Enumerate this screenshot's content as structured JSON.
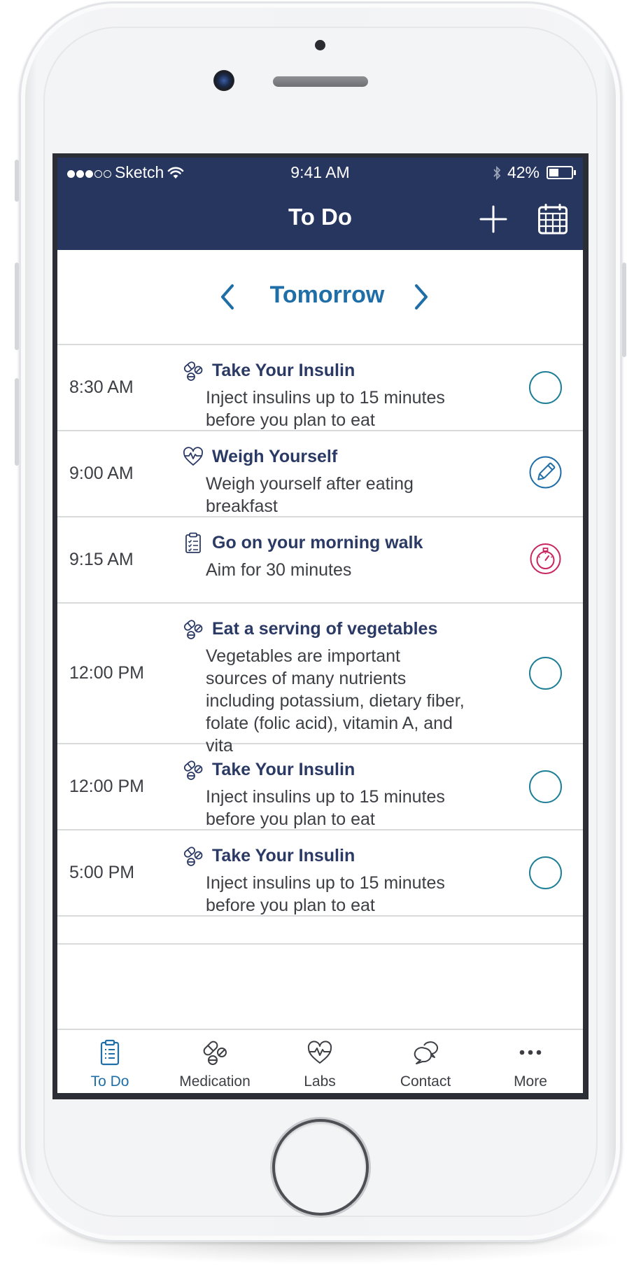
{
  "status_bar": {
    "signal_full": 3,
    "signal_empty": 2,
    "carrier": "Sketch",
    "time": "9:41 AM",
    "battery_percent": "42%",
    "battery_level": 0.42
  },
  "header": {
    "title": "To Do",
    "add_icon": "plus-icon",
    "calendar_icon": "calendar-icon"
  },
  "date_nav": {
    "label": "Tomorrow",
    "prev_icon": "chevron-left-icon",
    "next_icon": "chevron-right-icon"
  },
  "tasks": [
    {
      "time": "8:30 AM",
      "icon": "pills-icon",
      "title": "Take Your Insulin",
      "description": "Inject insulins up to 15 minutes before you plan to eat",
      "action": "complete-circle"
    },
    {
      "time": "9:00 AM",
      "icon": "heart-pulse-icon",
      "title": "Weigh Yourself",
      "description": "Weigh yourself after eating breakfast",
      "action": "edit-pencil"
    },
    {
      "time": "9:15 AM",
      "icon": "clipboard-checklist-icon",
      "title": "Go on your morning walk",
      "description": "Aim for 30 minutes",
      "action": "stopwatch"
    },
    {
      "time": "12:00 PM",
      "icon": "pills-icon",
      "title": "Eat a serving of vegetables",
      "description": "Vegetables are important sources of many nutrients including potassium, dietary fiber, folate (folic acid), vitamin A, and vita",
      "action": "complete-circle"
    },
    {
      "time": "12:00 PM",
      "icon": "pills-icon",
      "title": "Take Your Insulin",
      "description": "Inject insulins up to 15 minutes before you plan to eat",
      "action": "complete-circle"
    },
    {
      "time": "5:00 PM",
      "icon": "pills-icon",
      "title": "Take Your Insulin",
      "description": "Inject insulins up to 15 minutes before you plan to eat",
      "action": "complete-circle"
    }
  ],
  "tabbar": {
    "tabs": [
      {
        "label": "To Do",
        "icon": "clipboard-icon",
        "active": true
      },
      {
        "label": "Medication",
        "icon": "pills-icon",
        "active": false
      },
      {
        "label": "Labs",
        "icon": "heart-pulse-icon",
        "active": false
      },
      {
        "label": "Contact",
        "icon": "chat-bubbles-icon",
        "active": false
      },
      {
        "label": "More",
        "icon": "more-dots-icon",
        "active": false
      }
    ]
  },
  "colors": {
    "header_bg": "#27365f",
    "accent_blue": "#1f6ea7",
    "title_navy": "#2b3a65",
    "teal_circle": "#1f7f96",
    "stopwatch_pink": "#c8255f"
  }
}
